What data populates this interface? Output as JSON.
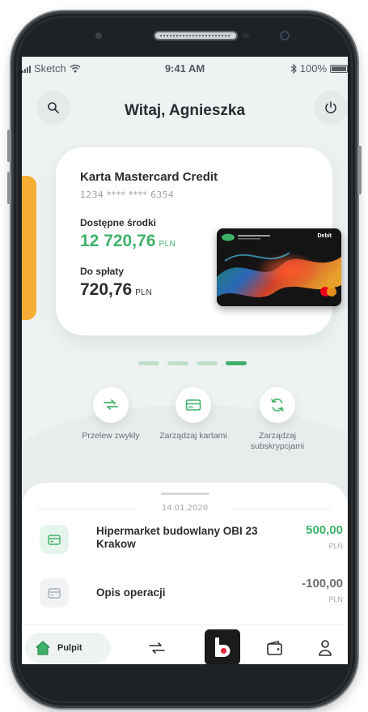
{
  "status_bar": {
    "carrier": "Sketch",
    "time": "9:41 AM",
    "battery": "100%"
  },
  "header": {
    "greeting": "Witaj, Agnieszka",
    "search_icon": "search-icon",
    "power_icon": "power-icon"
  },
  "card": {
    "title": "Karta Mastercard Credit",
    "number": "1234 **** **** 6354",
    "available_label": "Dostępne środki",
    "available_value": "12 720,76",
    "available_currency": "PLN",
    "due_label": "Do spłaty",
    "due_value": "720,76",
    "due_currency": "PLN",
    "bank_card_label": "Debit",
    "bank_card_brand": "mastercard"
  },
  "carousel": {
    "pages": 4,
    "active": 4
  },
  "actions": [
    {
      "label": "Przelew zwykły",
      "icon": "transfer-icon"
    },
    {
      "label": "Zarządzaj kartami",
      "icon": "card-icon"
    },
    {
      "label": "Zarządzaj subskrypcjami",
      "icon": "refresh-icon"
    }
  ],
  "transactions": {
    "date": "14.01.2020",
    "items": [
      {
        "name": "Hipermarket budowlany OBI 23 Krakow",
        "amount": "500,00",
        "currency": "PLN",
        "type": "credit"
      },
      {
        "name": "Opis operacji",
        "amount": "-100,00",
        "currency": "PLN",
        "type": "debit"
      }
    ]
  },
  "tabbar": {
    "home_label": "Pulpit",
    "items": [
      "home-icon",
      "transfer-icon",
      "bank-logo",
      "wallet-icon",
      "profile-icon"
    ]
  },
  "colors": {
    "accent_green": "#3fb26a",
    "orange": "#f5ad34",
    "background": "#eef2f2",
    "text_dark": "#2a2d30"
  }
}
